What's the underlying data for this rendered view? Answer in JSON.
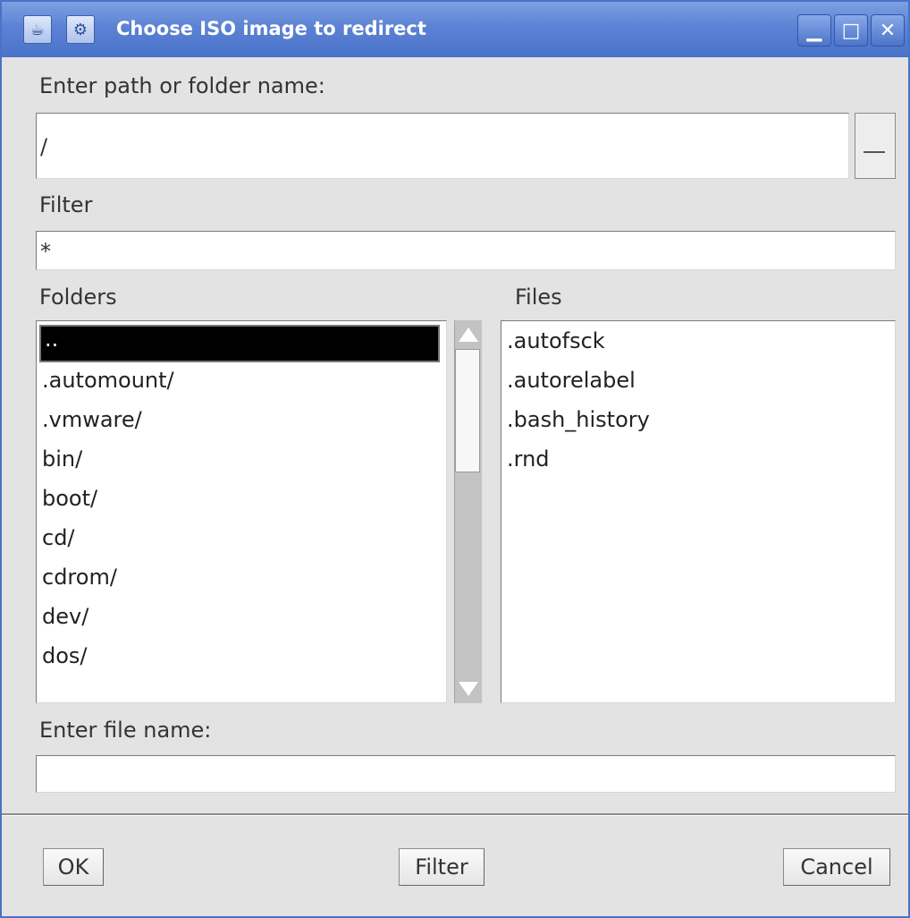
{
  "window": {
    "title": "Choose ISO image to redirect"
  },
  "path": {
    "label": "Enter path or folder name:",
    "value": "/"
  },
  "filter": {
    "label": "Filter",
    "value": "*"
  },
  "folders": {
    "label": "Folders",
    "selected": "..",
    "items": [
      ".automount/",
      ".vmware/",
      "bin/",
      "boot/",
      "cd/",
      "cdrom/",
      "dev/",
      "dos/"
    ]
  },
  "files": {
    "label": "Files",
    "items": [
      ".autofsck",
      ".autorelabel",
      ".bash_history",
      ".rnd"
    ]
  },
  "file_name": {
    "label": "Enter file name:",
    "value": ""
  },
  "buttons": {
    "ok": "OK",
    "filter": "Filter",
    "cancel": "Cancel"
  },
  "icons": {
    "app": "java-icon",
    "menu": "window-menu-icon",
    "minimize": "minimize-icon",
    "maximize": "maximize-icon",
    "close": "close-icon"
  }
}
